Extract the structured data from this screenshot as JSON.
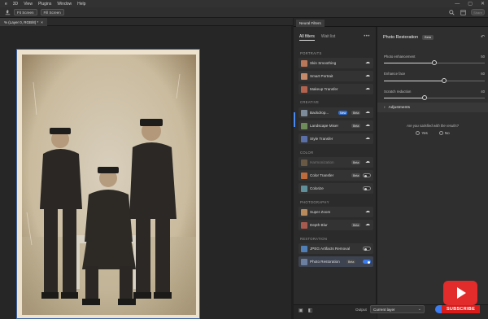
{
  "menubar": {
    "items": [
      "e",
      "3D",
      "View",
      "Plugins",
      "Window",
      "Help"
    ],
    "window_controls": [
      "—",
      "▢",
      "✕"
    ]
  },
  "options_bar": {
    "buttons": [
      "Fit Screen",
      "Fill Screen"
    ],
    "share_label": "Share"
  },
  "document": {
    "tab_label": "% (Layer 0, RGB/8) *",
    "close_glyph": "×"
  },
  "panel": {
    "tab_label": "Neural Filters",
    "filter_tabs": {
      "all": "All filters",
      "wait": "Wait list"
    },
    "more_glyph": "•••",
    "sections": {
      "portraits": "PORTRAITS",
      "creative": "CREATIVE",
      "color": "COLOR",
      "photography": "PHOTOGRAPHY",
      "restoration": "RESTORATION"
    },
    "filters": [
      {
        "name": "Skin Smoothing",
        "thumb": "#b9775a"
      },
      {
        "name": "Smart Portrait",
        "thumb": "#c48a6a"
      },
      {
        "name": "Makeup Transfer",
        "thumb": "#b4624d"
      },
      {
        "name": "Backdrop...",
        "thumb": "#7c8a9a",
        "badge": "New",
        "badge2": "Beta"
      },
      {
        "name": "Landscape Mixer",
        "thumb": "#6e8b5a",
        "badge": "Beta"
      },
      {
        "name": "Style Transfer",
        "thumb": "#5a6fa8"
      },
      {
        "name": "Harmonization",
        "thumb": "#8e7250",
        "badge": "Beta"
      },
      {
        "name": "Color Transfer",
        "thumb": "#c06b3c",
        "badge": "Beta"
      },
      {
        "name": "Colorize",
        "thumb": "#5f8f9a"
      },
      {
        "name": "Super Zoom",
        "thumb": "#b98a5c"
      },
      {
        "name": "Depth Blur",
        "thumb": "#a85a4e",
        "badge": "Beta"
      },
      {
        "name": "JPEG Artifacts Removal",
        "thumb": "#4f7fb6"
      },
      {
        "name": "Photo Restoration",
        "thumb": "#6c7fa0",
        "badge": "Beta"
      }
    ]
  },
  "settings": {
    "title": "Photo Restoration",
    "beta": "Beta",
    "sliders": [
      {
        "label": "Photo enhancement",
        "value": "50",
        "level": 0.5
      },
      {
        "label": "Enhance face",
        "value": "60",
        "level": 0.6
      },
      {
        "label": "Scratch reduction",
        "value": "40",
        "level": 0.4
      }
    ],
    "adjustments_label": "Adjustments",
    "feedback_question": "Are you satisfied with the results?",
    "yes": "Yes",
    "no": "No"
  },
  "footer": {
    "output_label": "Output",
    "output_value": "Current layer"
  },
  "overlay": {
    "subscribe": "SUBSCRIBE"
  },
  "colors": {
    "accent": "#3b7cf0",
    "youtube_red": "#e22b2b"
  }
}
